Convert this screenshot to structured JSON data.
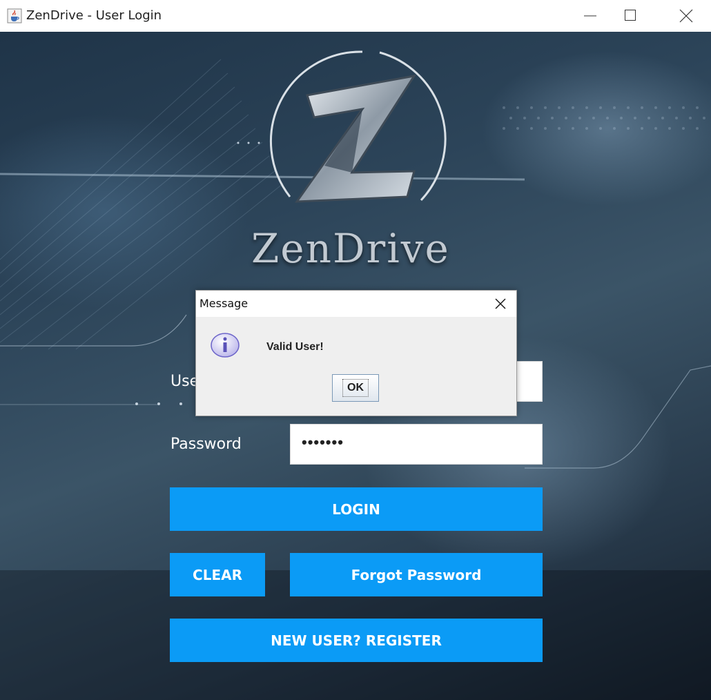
{
  "window": {
    "title": "ZenDrive - User Login",
    "icon": "java-cup-icon",
    "controls": [
      "minimize-icon",
      "maximize-icon",
      "close-icon"
    ]
  },
  "brand": {
    "logo_icon": "z-logo-icon",
    "name": "ZenDrive"
  },
  "form": {
    "username_label": "Use",
    "username_value": "",
    "password_label": "Password",
    "password_value": "•••••••"
  },
  "buttons": {
    "login": "LOGIN",
    "clear": "CLEAR",
    "forgot": "Forgot Password",
    "register": "NEW USER? REGISTER"
  },
  "dialog": {
    "title": "Message",
    "icon": "info-icon",
    "message": "Valid User!",
    "ok_label": "OK"
  },
  "colors": {
    "accent": "#0b9bf6",
    "background_dark": "#1f3448",
    "dialog_bg": "#efefef"
  }
}
